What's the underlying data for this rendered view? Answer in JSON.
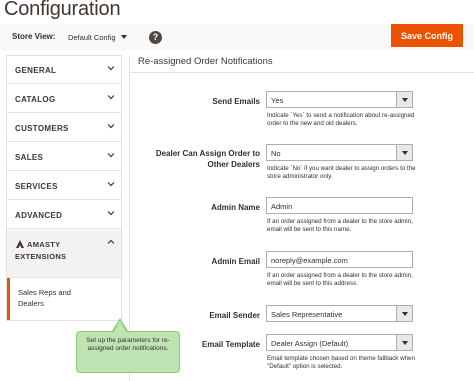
{
  "header": {
    "title": "Configuration",
    "store_view_label": "Store View:",
    "store_view_value": "Default Config",
    "save_button": "Save Config"
  },
  "sidebar": {
    "items": [
      {
        "label": "GENERAL"
      },
      {
        "label": "CATALOG"
      },
      {
        "label": "CUSTOMERS"
      },
      {
        "label": "SALES"
      },
      {
        "label": "SERVICES"
      },
      {
        "label": "ADVANCED"
      }
    ],
    "amasty_line1": "AMASTY",
    "amasty_line2": "EXTENSIONS",
    "active_subitem": "Sales Reps and Dealers"
  },
  "section": {
    "title": "Re-assigned Order Notifications"
  },
  "fields": {
    "send_emails": {
      "label": "Send Emails",
      "value": "Yes",
      "note": "Indicate `Yes` to send a notification about re-assigned order to the new and old dealers."
    },
    "dealer_assign": {
      "label_line1": "Dealer Can Assign Order to",
      "label_line2": "Other Dealers",
      "value": "No",
      "note": "Indicate `No` if you want dealer to assign orders to the store administrator only."
    },
    "admin_name": {
      "label": "Admin Name",
      "value": "Admin",
      "note": "If an order assigned from a dealer to the store admin, email will be sent to this name."
    },
    "admin_email": {
      "label": "Admin Email",
      "value": "noreply@example.com",
      "note": "If an order assigned from a dealer to the store admin, email will be sent to this address."
    },
    "email_sender": {
      "label": "Email Sender",
      "value": "Sales Representative"
    },
    "email_template": {
      "label": "Email Template",
      "value": "Dealer Assign (Default)",
      "note": "Email template chosen based on theme fallback when \"Default\" option is selected."
    }
  },
  "tooltip": {
    "text": "Set up the parameters for re-assigned order notifications."
  },
  "colors": {
    "accent": "#eb5202",
    "tooltip_bg": "#bee4b3"
  }
}
